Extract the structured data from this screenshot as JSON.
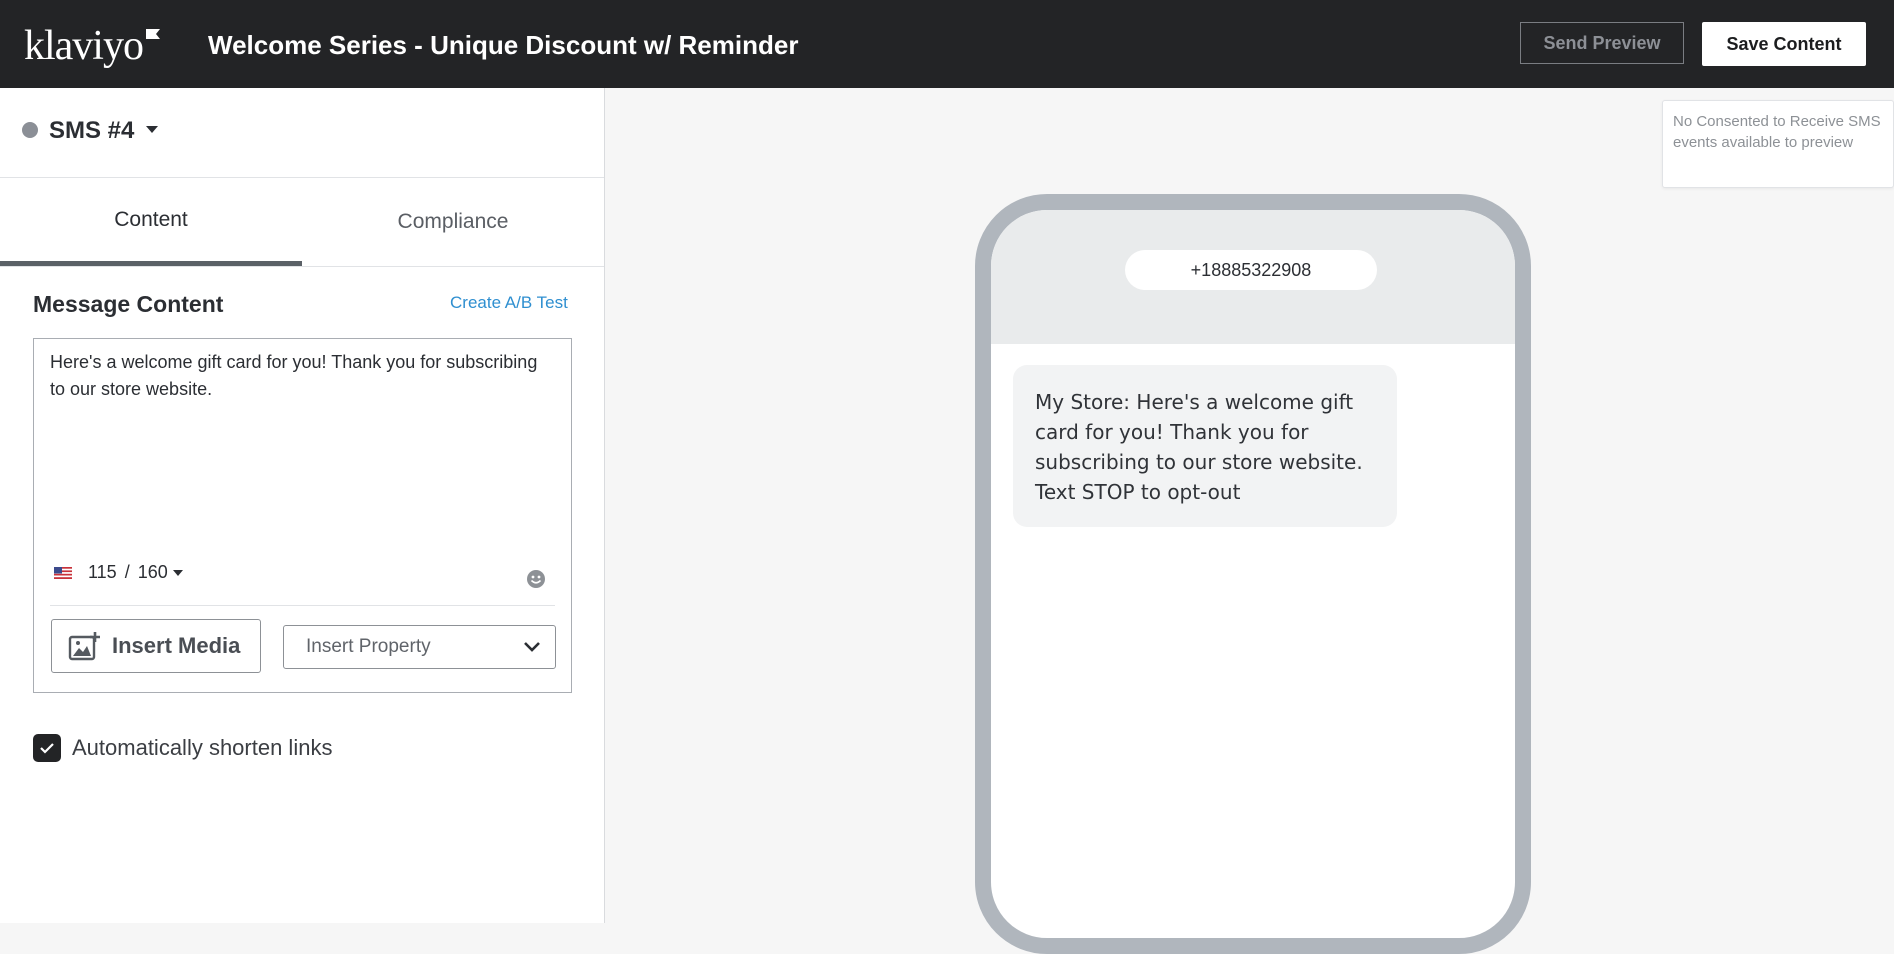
{
  "brand": {
    "logo_text": "klaviyo"
  },
  "header": {
    "title": "Welcome Series - Unique Discount w/ Reminder",
    "send_preview_label": "Send Preview",
    "save_label": "Save Content"
  },
  "message": {
    "name": "SMS #4",
    "tabs": [
      {
        "label": "Content"
      },
      {
        "label": "Compliance"
      }
    ],
    "section_title": "Message Content",
    "ab_test_label": "Create A/B Test",
    "body": "Here's a welcome gift card for you! Thank you for subscribing to our store website.",
    "char_count": "115",
    "char_limit": "160",
    "insert_media_label": "Insert Media",
    "insert_property_placeholder": "Insert Property",
    "shorten_links_label": "Automatically shorten links"
  },
  "preview": {
    "phone_number": "+18885322908",
    "message_preview": "My Store: Here's a welcome gift card for you! Thank you for subscribing to our store website. Text STOP to opt-out",
    "notice": "No Consented to Receive SMS events available to preview"
  },
  "colors": {
    "topbar": "#232426",
    "link": "#2f8fd0",
    "phone_frame": "#b0b6bd",
    "bubble": "#f2f3f4"
  }
}
